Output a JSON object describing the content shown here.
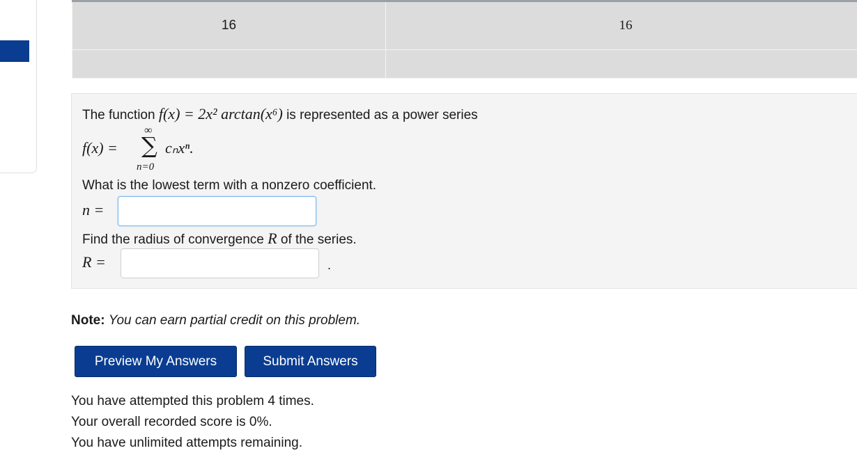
{
  "answer_table": {
    "row1": [
      "16",
      "16"
    ],
    "row2": [
      "",
      ""
    ]
  },
  "problem": {
    "intro_text": "The function",
    "intro_func": "f(x) = 2x² arctan(x⁶)",
    "intro_suffix": "is represented as a power series",
    "series_lhs": "f(x) =",
    "series_top": "∞",
    "series_sigma": "∑",
    "series_bottom": "n=0",
    "series_term": "cₙxⁿ.",
    "question1": "What is the lowest term with a nonzero coefficient.",
    "n_label": "n =",
    "n_value": "",
    "question2_pre": "Find the radius of convergence",
    "question2_var": "R",
    "question2_post": "of the series.",
    "r_label": "R =",
    "r_value": "",
    "r_suffix": "."
  },
  "note": {
    "label": "Note:",
    "text": "You can earn partial credit on this problem."
  },
  "buttons": {
    "preview": "Preview My Answers",
    "submit": "Submit Answers"
  },
  "status": {
    "attempts": "You have attempted this problem 4 times.",
    "score": "Your overall recorded score is 0%.",
    "remaining": "You have unlimited attempts remaining."
  },
  "colors": {
    "accent": "#0a3d91",
    "problem_bg": "#f4f4f4",
    "table_cell_bg": "#dcdcdc",
    "focus_border": "#7db7f0"
  }
}
